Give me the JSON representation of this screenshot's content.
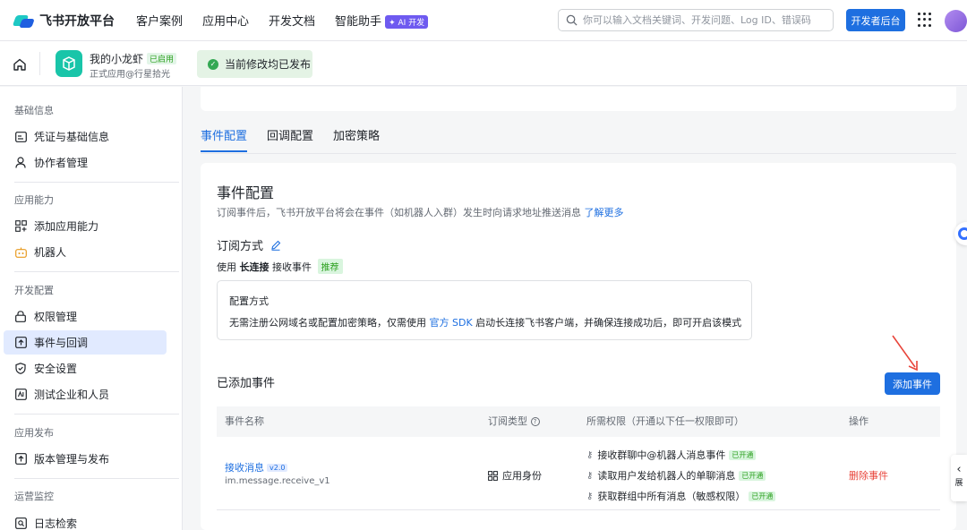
{
  "topnav": {
    "brand": "飞书开放平台",
    "links": [
      "客户案例",
      "应用中心",
      "开发文档",
      "智能助手"
    ],
    "ai_badge": "✦ AI 开发",
    "search_placeholder": "你可以输入文档关键词、开发问题、Log ID、错误码",
    "dev_console": "开发者后台"
  },
  "appbar": {
    "app_name": "我的小龙虾",
    "app_status": "已启用",
    "app_subtitle": "正式应用@行星拾光",
    "publish_status": "当前修改均已发布"
  },
  "sidebar": {
    "groups": [
      {
        "title": "基础信息",
        "items": [
          {
            "label": "凭证与基础信息",
            "icon": "id-card-icon"
          },
          {
            "label": "协作者管理",
            "icon": "user-icon"
          }
        ]
      },
      {
        "title": "应用能力",
        "items": [
          {
            "label": "添加应用能力",
            "icon": "grid-add-icon"
          },
          {
            "label": "机器人",
            "icon": "robot-icon"
          }
        ]
      },
      {
        "title": "开发配置",
        "items": [
          {
            "label": "权限管理",
            "icon": "lock-icon"
          },
          {
            "label": "事件与回调",
            "icon": "event-icon",
            "active": true
          },
          {
            "label": "安全设置",
            "icon": "shield-icon"
          },
          {
            "label": "测试企业和人员",
            "icon": "test-icon"
          }
        ]
      },
      {
        "title": "应用发布",
        "items": [
          {
            "label": "版本管理与发布",
            "icon": "upload-icon"
          }
        ]
      },
      {
        "title": "运营监控",
        "items": [
          {
            "label": "日志检索",
            "icon": "search-log-icon"
          }
        ]
      }
    ]
  },
  "tabs": [
    "事件配置",
    "回调配置",
    "加密策略"
  ],
  "event_config": {
    "title": "事件配置",
    "desc": "订阅事件后，飞书开放平台将会在事件（如机器人入群）发生时向请求地址推送消息",
    "learn_more": "了解更多",
    "sub_method_title": "订阅方式",
    "sub_prefix": "使用",
    "sub_method": "长连接",
    "sub_suffix": "接收事件",
    "recommend": "推荐",
    "config_title": "配置方式",
    "config_desc_1": "无需注册公网域名或配置加密策略，仅需使用",
    "config_link": "官方 SDK",
    "config_desc_2": "启动长连接飞书客户端，并确保连接成功后，即可开启该模式"
  },
  "added_events": {
    "title": "已添加事件",
    "add_button": "添加事件",
    "columns": [
      "事件名称",
      "订阅类型",
      "所需权限（开通以下任一权限即可）",
      "操作"
    ],
    "rows": [
      {
        "name": "接收消息",
        "version": "v2.0",
        "code": "im.message.receive_v1",
        "sub_type": "应用身份",
        "permissions": [
          {
            "label": "接收群聊中@机器人消息事件",
            "status": "已开通"
          },
          {
            "label": "读取用户发给机器人的单聊消息",
            "status": "已开通"
          },
          {
            "label": "获取群组中所有消息（敏感权限）",
            "status": "已开通"
          }
        ],
        "action": "删除事件"
      }
    ]
  },
  "float": {
    "side_tab": "展"
  },
  "colors": {
    "primary": "#1e6fe0",
    "success": "#2ea121",
    "danger": "#e8443a",
    "active_bg": "#e1eaff"
  }
}
